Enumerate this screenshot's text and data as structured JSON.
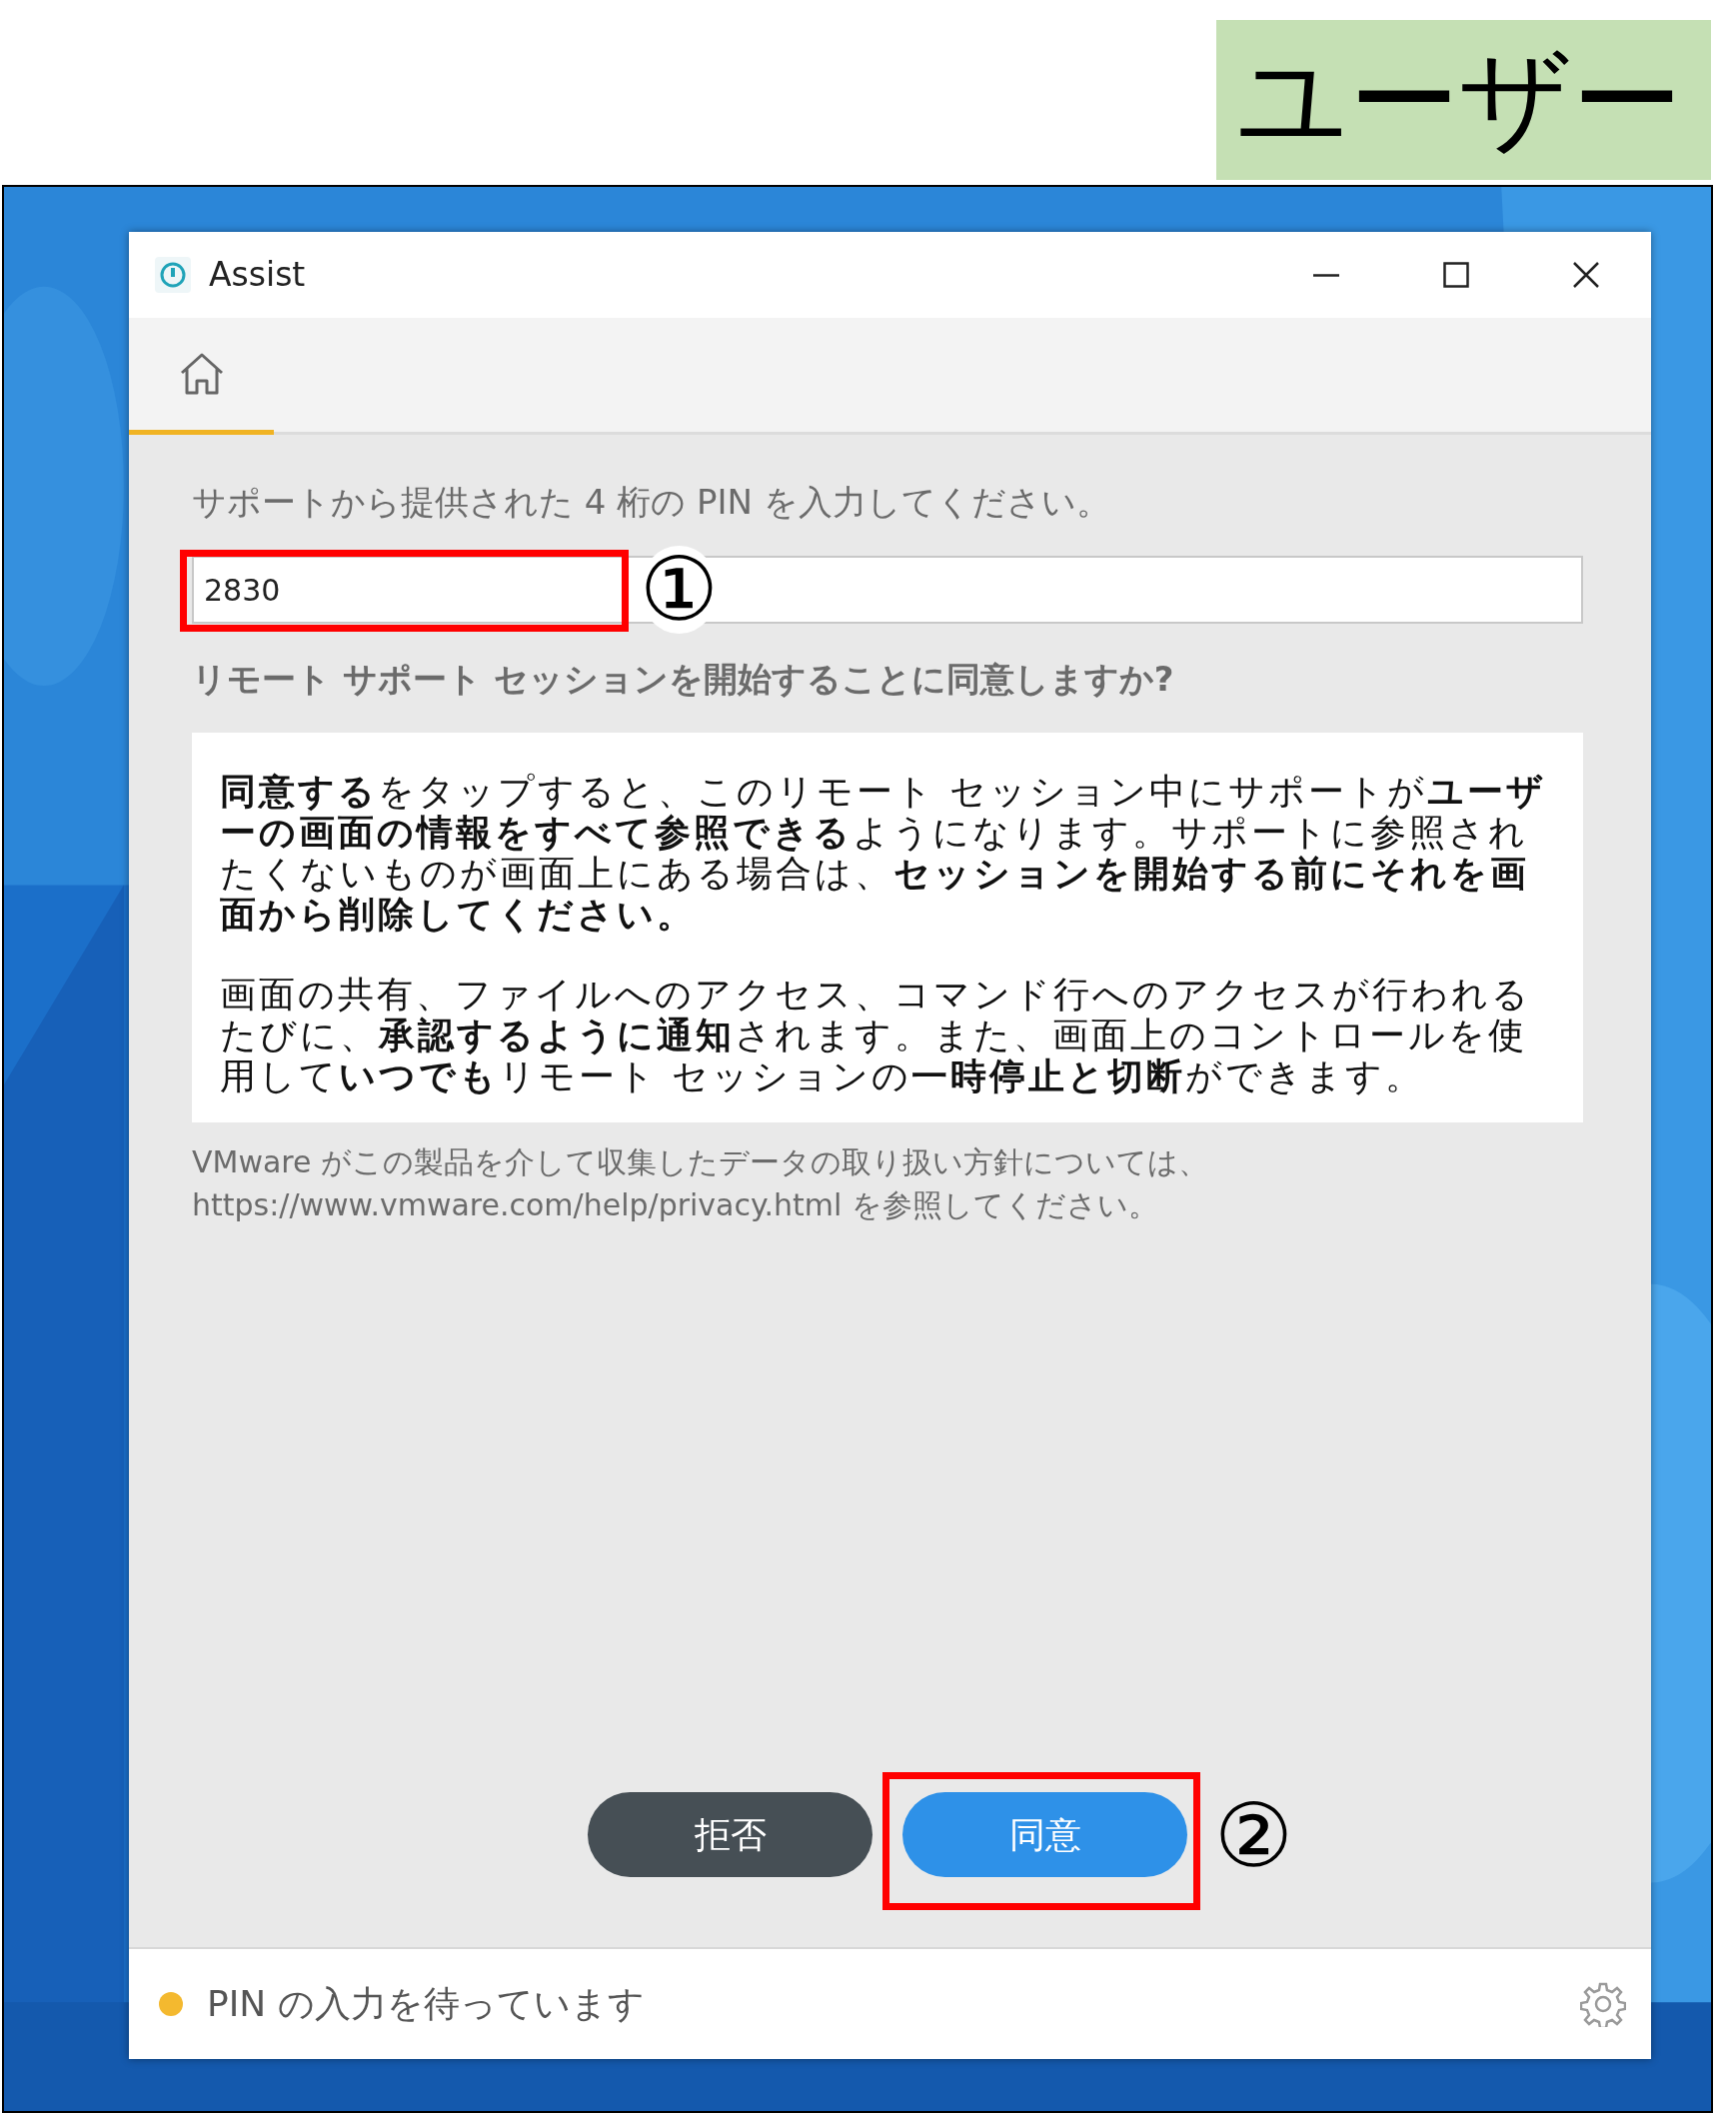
{
  "header_label": {
    "text": "ユーザー",
    "color": "#c5e0b4"
  },
  "window": {
    "title": "Assist",
    "controls": [
      {
        "kind": "minimize"
      },
      {
        "kind": "maximize"
      },
      {
        "kind": "close"
      }
    ]
  },
  "toolbar": {
    "tabs": [
      {
        "kind": "home",
        "selected": true
      }
    ]
  },
  "pin_prompt": "サポートから提供された 4 桁の PIN を入力してください。",
  "pin_field": {
    "value": "2830",
    "annotation": "①",
    "highlighted": true
  },
  "question": "リモート サポート セッションを開始することに同意しますか?",
  "consent_paragraphs": [
    "**同意する**をタップすると、このリモート セッション中にサポートが**ユーザーの画面の情報をすべて参照できる**ようになります。サポートに参照されたくないものが画面上にある場合は、**セッションを開始する前にそれを画面から削除してください。**",
    "画面の共有、ファイルへのアクセス、コマンド行へのアクセスが行われるたびに、**承認するように通知**されます。また、画面上のコントロールを使用して**いつでも**リモート セッションの**一時停止と切断**ができます。"
  ],
  "privacy_note": "VMware がこの製品を介して収集したデータの取り扱い方針については、https://www.vmware.com/help/privacy.html を参照してください。",
  "buttons": [
    {
      "label": "拒否",
      "kind": "secondary",
      "highlighted": false
    },
    {
      "label": "同意",
      "kind": "primary",
      "highlighted": true,
      "annotation": "②"
    }
  ],
  "status_bar": {
    "text": "PIN の入力を待っています",
    "color": "#f4b92f"
  }
}
